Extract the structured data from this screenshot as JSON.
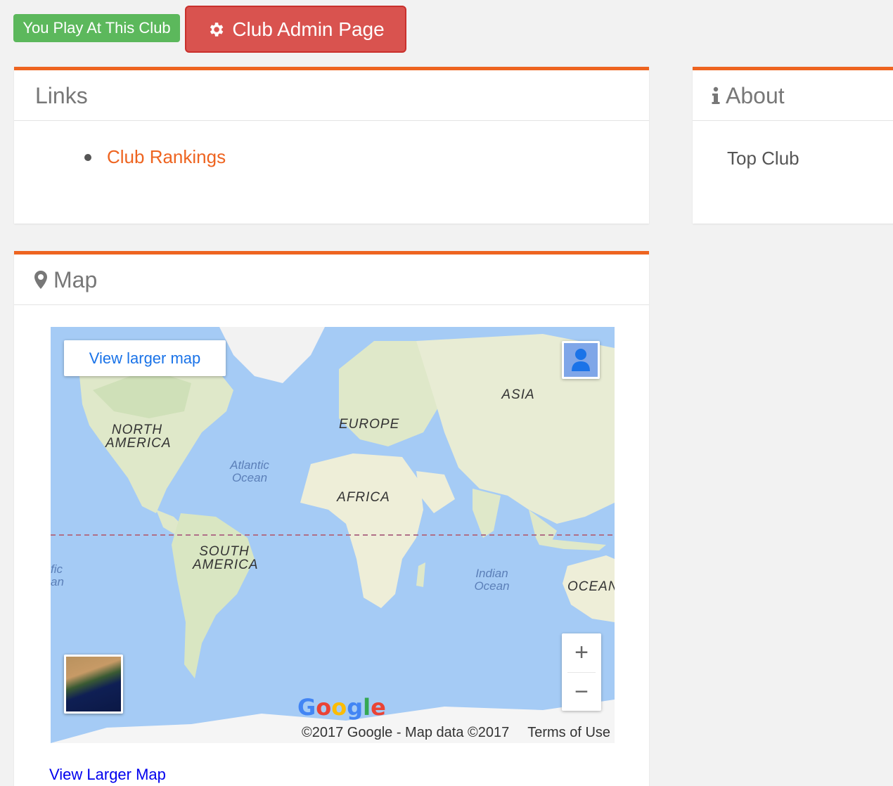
{
  "top": {
    "play_badge": "You Play At This Club",
    "admin_button": "Club Admin Page"
  },
  "links_panel": {
    "title": "Links",
    "items": [
      "Club Rankings"
    ]
  },
  "about_panel": {
    "title": "About",
    "text": "Top Club"
  },
  "map_panel": {
    "title": "Map",
    "view_larger_button": "View larger map",
    "labels": {
      "north_america": "NORTH AMERICA",
      "europe": "EUROPE",
      "asia": "ASIA",
      "africa": "AFRICA",
      "south_america": "SOUTH AMERICA",
      "oceania": "OCEANI",
      "atlantic": "Atlantic Ocean",
      "indian": "Indian Ocean",
      "pacific": "fic an"
    },
    "google_logo": "Google",
    "attribution": "©2017 Google - Map data ©2017",
    "terms": "Terms of Use",
    "zoom_in": "+",
    "zoom_out": "−",
    "view_larger_link": "View Larger Map"
  },
  "colors": {
    "accent": "#ee6420",
    "green": "#5cb85c",
    "red": "#d9534f",
    "ocean": "#a5cbf5",
    "land": "#e8ecd4"
  }
}
